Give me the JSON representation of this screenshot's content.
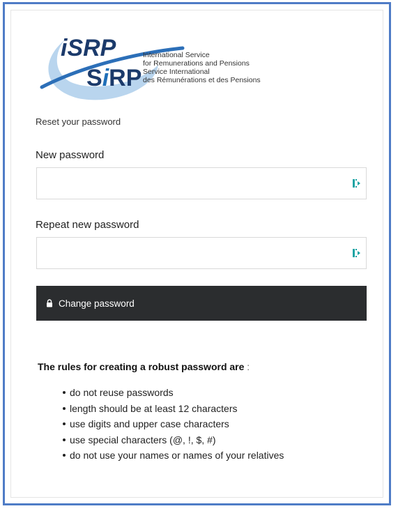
{
  "logo": {
    "mark_top": "iSRP",
    "mark_bottom_s": "S",
    "mark_bottom_i": "i",
    "mark_bottom_rp": "RP",
    "lines": [
      "International Service",
      "for Remunerations and Pensions",
      "Service International",
      "des Rémunérations et des Pensions"
    ],
    "colors": {
      "blue": "#1f6fb8",
      "navy": "#1b3a6b",
      "swoosh": "#6fa7dc"
    }
  },
  "form": {
    "heading": "Reset your password",
    "new_password_label": "New password",
    "repeat_password_label": "Repeat new password",
    "new_password_value": "",
    "repeat_password_value": "",
    "submit_label": "Change password"
  },
  "rules": {
    "title": "The rules for creating a robust password are",
    "title_suffix": " :",
    "items": [
      "do not reuse passwords",
      "length should be at least 12 characters",
      "use digits and upper case characters",
      "use special characters (@, !, $, #)",
      "do not use your names or names of your relatives"
    ]
  },
  "icons": {
    "reveal": "password-reveal-icon",
    "lock": "lock-icon"
  },
  "colors": {
    "frame_border": "#4f7cc6",
    "button_bg": "#2b2d2f",
    "reveal_icon": "#1aa3a3"
  }
}
